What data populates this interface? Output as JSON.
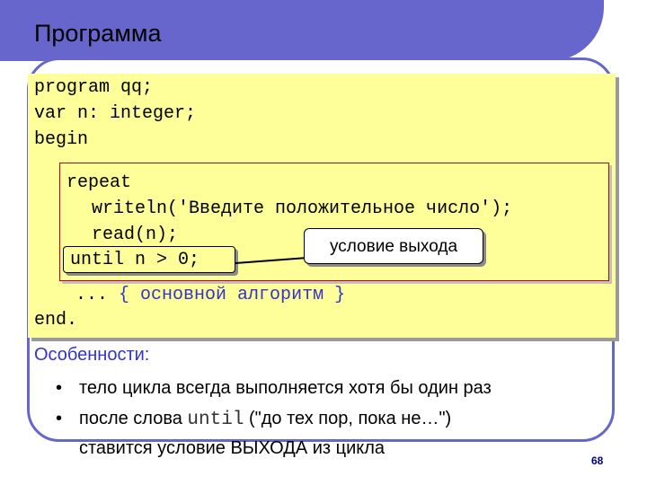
{
  "slide": {
    "title": "Программа",
    "page_number": "68"
  },
  "code": {
    "line1": "program qq;",
    "line2": "var n: integer;",
    "line3": "begin",
    "repeat_kw": "repeat",
    "writeln": "writeln('Введите положительное число');",
    "read": "read(n);",
    "until": "until n > 0;",
    "ellipsis": "...",
    "comment": "{ основной алгоритм }",
    "end": "end."
  },
  "callout": {
    "label": "условие выхода"
  },
  "features": {
    "heading": "Особенности:",
    "bullet_char": "•",
    "item1": "тело цикла всегда выполняется хотя бы один раз",
    "item2_before": "после слова ",
    "item2_keyword": "until",
    "item2_after": " (\"до тех пор, пока не…\")",
    "item2_line2": "ставится условие ВЫХОДА из цикла"
  },
  "colors": {
    "banner": "#6666cc",
    "code_background": "#ffff99",
    "heading_text": "#3333cc",
    "repeat_border": "#cc0000"
  }
}
